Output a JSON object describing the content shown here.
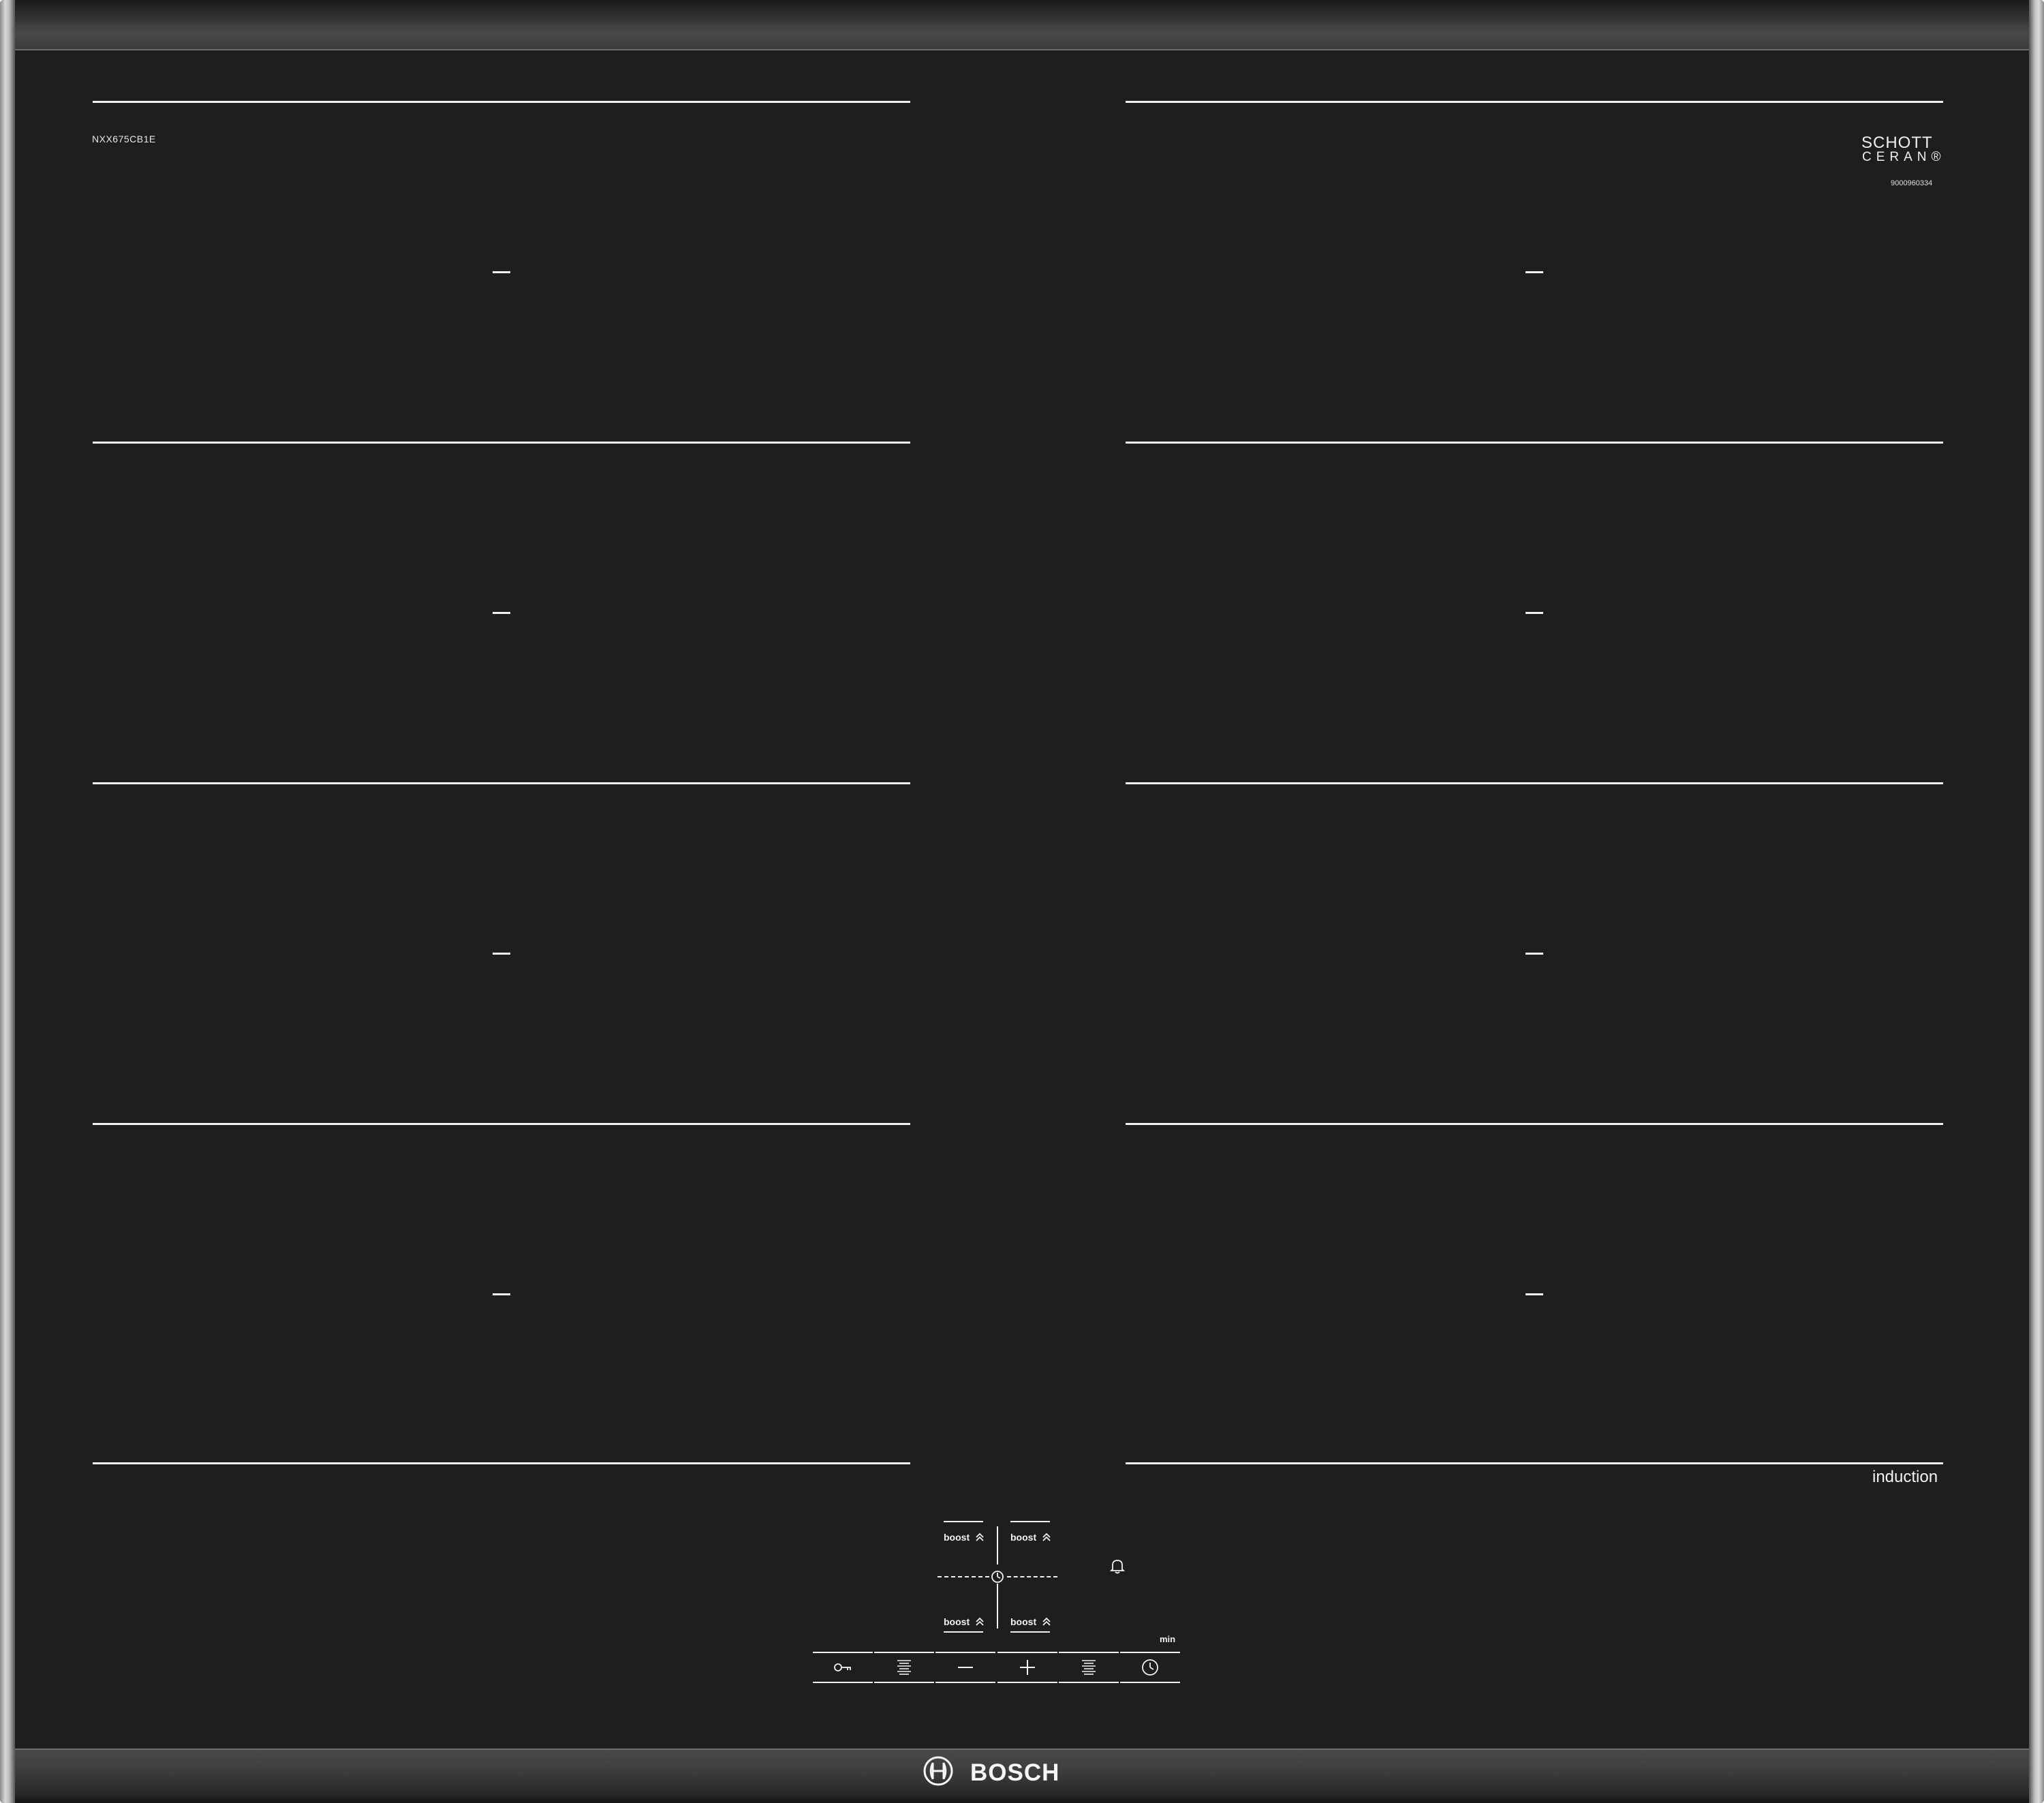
{
  "cooktop": {
    "model": "NXX675CB1E",
    "glass_brand": {
      "line1": "SCHOTT",
      "line2": "CERAN®"
    },
    "serial": "9000960334",
    "type_label": "induction",
    "brand": "BOSCH",
    "zone_count": 8,
    "colors": {
      "glass": "#1f1e1c",
      "markings": "#f2f2f2",
      "frame": "#cfcfcf"
    }
  },
  "controls": {
    "boost_label": "boost",
    "boost_buttons": [
      {
        "label": "boost",
        "icon": "double-chevron-up-icon"
      },
      {
        "label": "boost",
        "icon": "double-chevron-up-icon"
      },
      {
        "label": "boost",
        "icon": "double-chevron-up-icon"
      },
      {
        "label": "boost",
        "icon": "double-chevron-up-icon"
      }
    ],
    "zone_selector_icon": "timer-dial-icon",
    "alarm_icon": "bell-icon",
    "timer_unit": "min",
    "strip": [
      {
        "icon": "key-lock-icon"
      },
      {
        "icon": "heat-level-left-icon"
      },
      {
        "icon": "minus-icon"
      },
      {
        "icon": "plus-icon"
      },
      {
        "icon": "heat-level-right-icon"
      },
      {
        "icon": "clock-icon"
      }
    ]
  }
}
